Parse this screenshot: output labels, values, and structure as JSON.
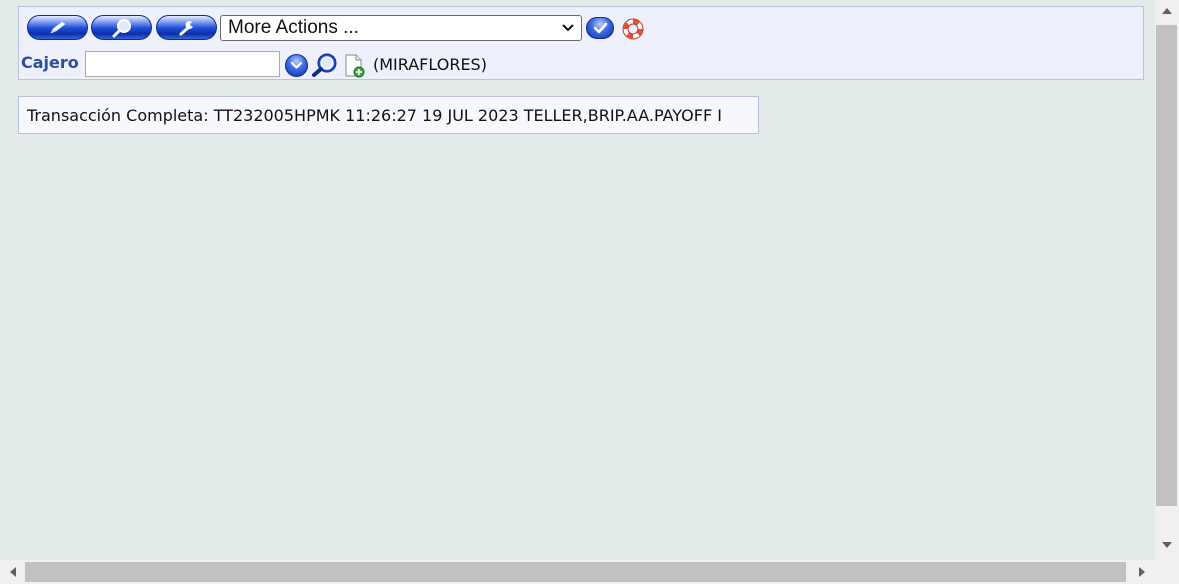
{
  "toolbar": {
    "buttons": [
      {
        "name": "edit",
        "icon": "pencil-icon"
      },
      {
        "name": "find",
        "icon": "magnifier-icon"
      },
      {
        "name": "tools",
        "icon": "wrench-icon"
      }
    ],
    "actions_select_value": "More Actions ...",
    "commit_icon": "checkmark-icon",
    "help_icon": "lifebuoy-icon"
  },
  "record": {
    "field_label": "Cajero",
    "field_value": "",
    "dropdown_icon": "chevron-down-icon",
    "search_icon": "magnifier-icon",
    "new_icon": "new-document-icon",
    "branch": "(MIRAFLORES)"
  },
  "message": {
    "text": "Transacción Completa: TT232005HPMK 11:26:27 19 JUL 2023 TELLER,BRIP.AA.PAYOFF I"
  },
  "colors": {
    "page_background": "#e2eaea",
    "panel_background": "#eef0fb",
    "panel_border": "#b8c2dc",
    "button_blue": "#1f4fd6",
    "label_blue": "#2f4f9a",
    "scroll_thumb": "#c1c1c1"
  }
}
